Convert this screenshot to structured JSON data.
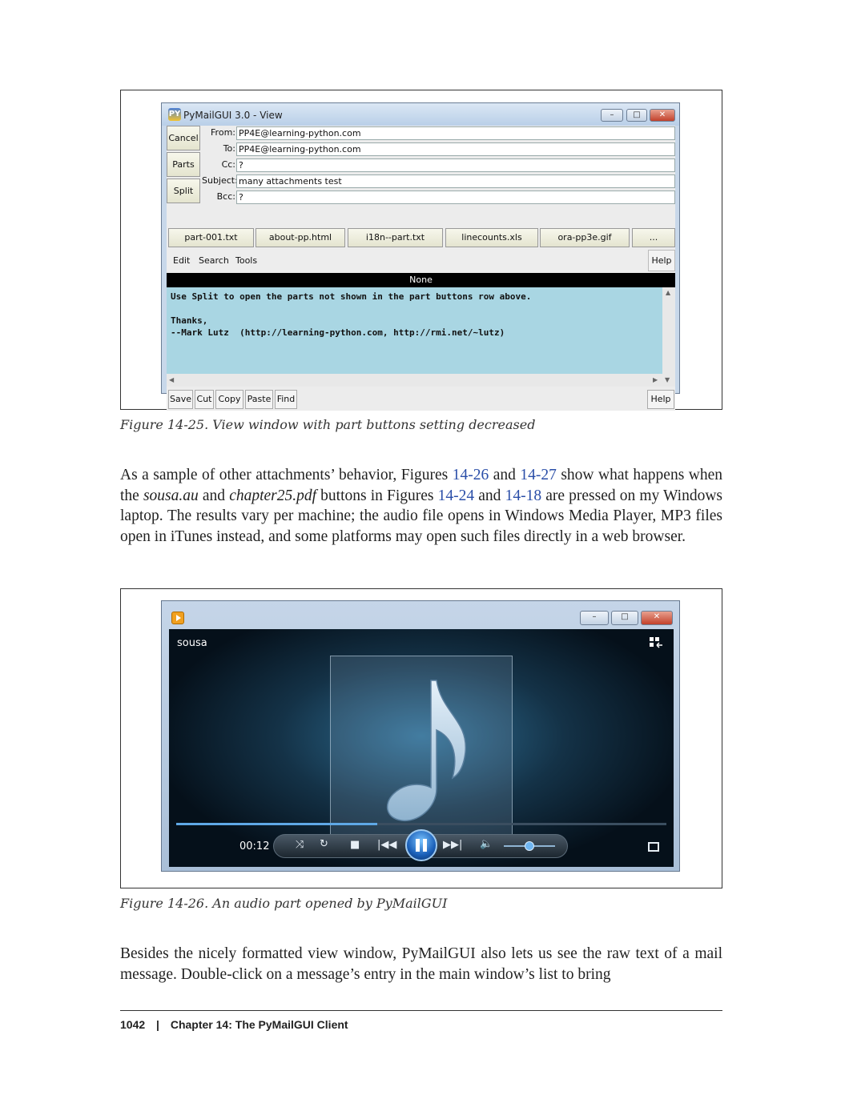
{
  "figure1": {
    "caption": "Figure 14-25. View window with part buttons setting decreased",
    "window": {
      "title": "PyMailGUI 3.0 - View",
      "logo_text": "PY",
      "side_buttons": [
        "Cancel",
        "Parts",
        "Split"
      ],
      "headers": [
        {
          "label": "From:",
          "value": "PP4E@learning-python.com"
        },
        {
          "label": "To:",
          "value": "PP4E@learning-python.com"
        },
        {
          "label": "Cc:",
          "value": "?"
        },
        {
          "label": "Subject:",
          "value": "many attachments test"
        },
        {
          "label": "Bcc:",
          "value": "?"
        }
      ],
      "part_buttons": [
        "part-001.txt",
        "about-pp.html",
        "i18n--part.txt",
        "linecounts.xls",
        "ora-pp3e.gif",
        "..."
      ],
      "menu": {
        "edit": "Edit",
        "search": "Search",
        "tools": "Tools",
        "help": "Help"
      },
      "status_bar": "None",
      "body_text": "Use Split to open the parts not shown in the part buttons row above.\n\nThanks,\n--Mark Lutz  (http://learning-python.com, http://rmi.net/~lutz)",
      "toolbar": {
        "save": "Save",
        "cut": "Cut",
        "copy": "Copy",
        "paste": "Paste",
        "find": "Find",
        "help": "Help"
      }
    }
  },
  "paragraph1": {
    "t1": "As a sample of other attachments’ behavior, Figures ",
    "l1": "14-26",
    "t2": " and ",
    "l2": "14-27",
    "t3": " show what happens when the ",
    "e1": "sousa.au",
    "t4": " and ",
    "e2": "chapter25.pdf",
    "t5": " buttons in Figures ",
    "l3": "14-24",
    "t6": " and ",
    "l4": "14-18",
    "t7": " are pressed on my Windows laptop. The results vary per machine; the audio file opens in Windows Media Player, MP3 files open in iTunes instead, and some platforms may open such files directly in a web browser."
  },
  "figure2": {
    "caption": "Figure 14-26. An audio part opened by PyMailGUI",
    "player": {
      "track_title": "sousa",
      "time": "00:12",
      "progress": 0.41,
      "volume": 0.5
    }
  },
  "paragraph2": "Besides the nicely formatted view window, PyMailGUI also lets us see the raw text of a mail message. Double-click on a message’s entry in the main window’s list to bring",
  "footer": {
    "page": "1042",
    "separator": "|",
    "chapter": "Chapter 14: The PyMailGUI Client"
  },
  "colors": {
    "link": "#2a4ea8",
    "body_bg": "#a9d6e3",
    "accent": "#1a5fb8"
  }
}
